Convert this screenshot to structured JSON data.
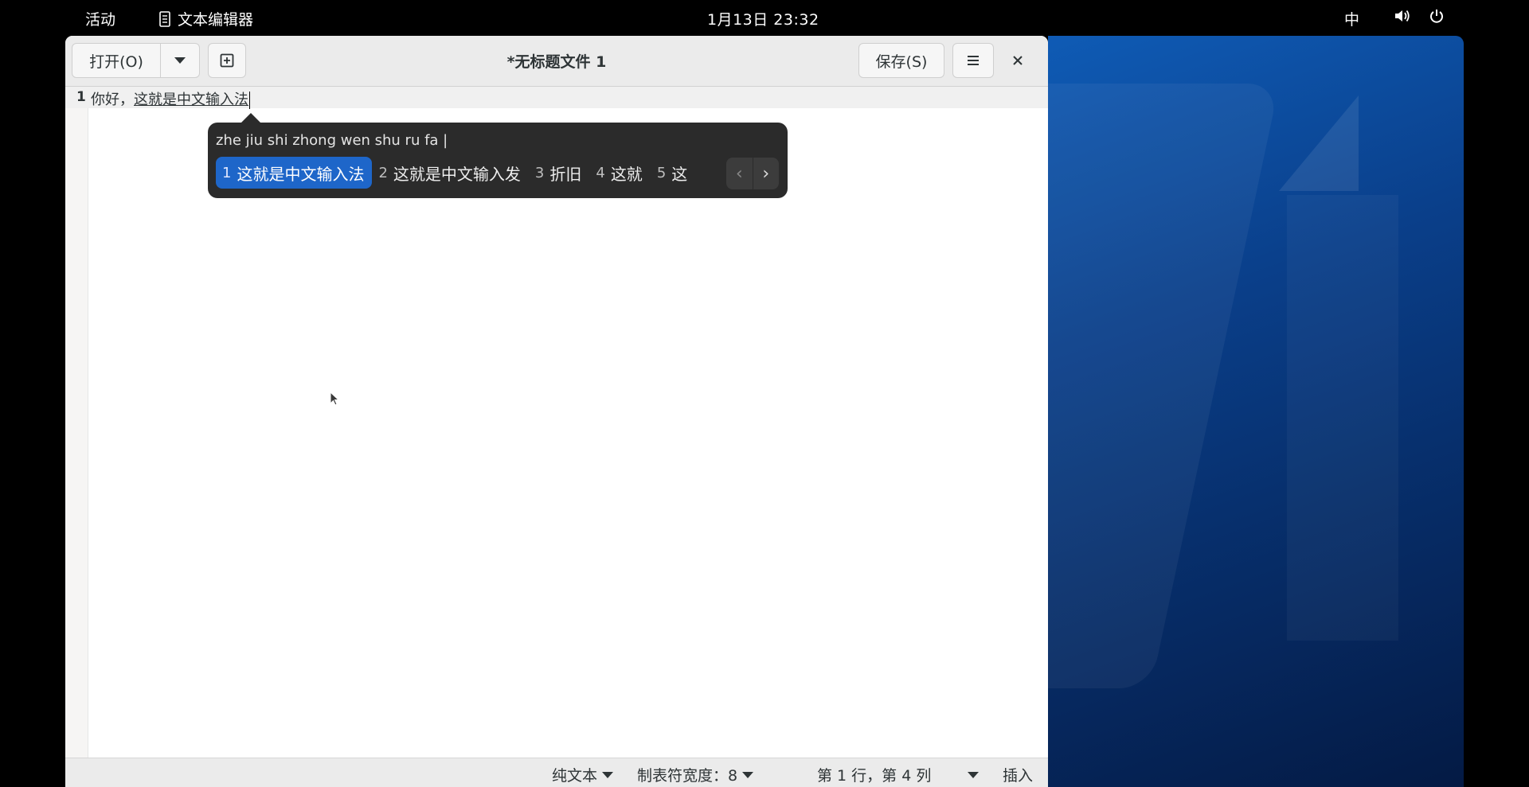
{
  "topbar": {
    "activities": "活动",
    "app_name": "文本编辑器",
    "clock": "1月13日  23:32",
    "input_method": "中"
  },
  "editor": {
    "title": "*无标题文件 1",
    "open_label": "打开(O)",
    "save_label": "保存(S)",
    "line_number": "1",
    "text_committed": "你好，",
    "text_preedit": "这就是中文输入法"
  },
  "ime": {
    "preedit": "zhe jiu shi zhong wen shu ru fa |",
    "candidates": [
      {
        "num": "1",
        "text": "这就是中文输入法",
        "selected": true
      },
      {
        "num": "2",
        "text": "这就是中文输入发"
      },
      {
        "num": "3",
        "text": "折旧"
      },
      {
        "num": "4",
        "text": "这就"
      },
      {
        "num": "5",
        "text": "这"
      }
    ]
  },
  "statusbar": {
    "language": "纯文本",
    "tab_width": "制表符宽度：8",
    "position": "第 1 行，第 4 列",
    "mode": "插入"
  },
  "colors": {
    "accent": "#1e66c9",
    "ime_bg": "#2b2b2b",
    "headerbar_bg": "#ebebeb",
    "desktop_blue": "#0a3f8a"
  }
}
